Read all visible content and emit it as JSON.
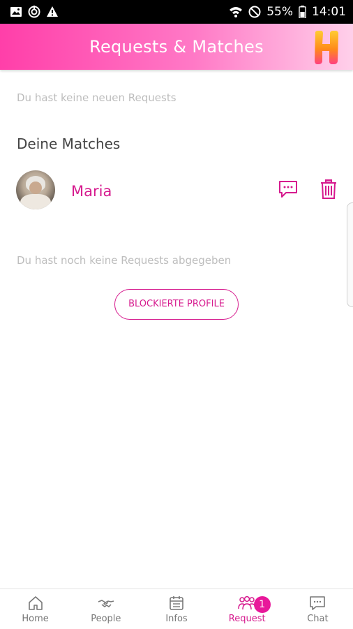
{
  "status_bar": {
    "battery": "55%",
    "time": "14:01",
    "left_icons": [
      "image-icon",
      "sync-icon",
      "warning-icon"
    ],
    "right_icons": [
      "wifi-icon",
      "do-not-disturb-icon",
      "battery-icon"
    ]
  },
  "header": {
    "title": "Requests & Matches",
    "logo_letter": "H"
  },
  "content": {
    "no_new_requests": "Du hast keine neuen Requests",
    "matches_title": "Deine Matches",
    "matches": [
      {
        "name": "Maria"
      }
    ],
    "no_sent_requests": "Du hast noch keine Requests abgegeben",
    "blocked_button": "BLOCKIERTE PROFILE"
  },
  "bottom_nav": {
    "items": [
      {
        "label": "Home",
        "icon": "home-icon"
      },
      {
        "label": "People",
        "icon": "handshake-icon"
      },
      {
        "label": "Infos",
        "icon": "calendar-icon"
      },
      {
        "label": "Request",
        "icon": "group-icon",
        "badge": "1",
        "active": true
      },
      {
        "label": "Chat",
        "icon": "chat-icon"
      }
    ]
  },
  "colors": {
    "accent": "#d61a8e",
    "header_start": "#ff3fa9",
    "header_end": "#ffd0ea",
    "badge": "#e8189a"
  }
}
